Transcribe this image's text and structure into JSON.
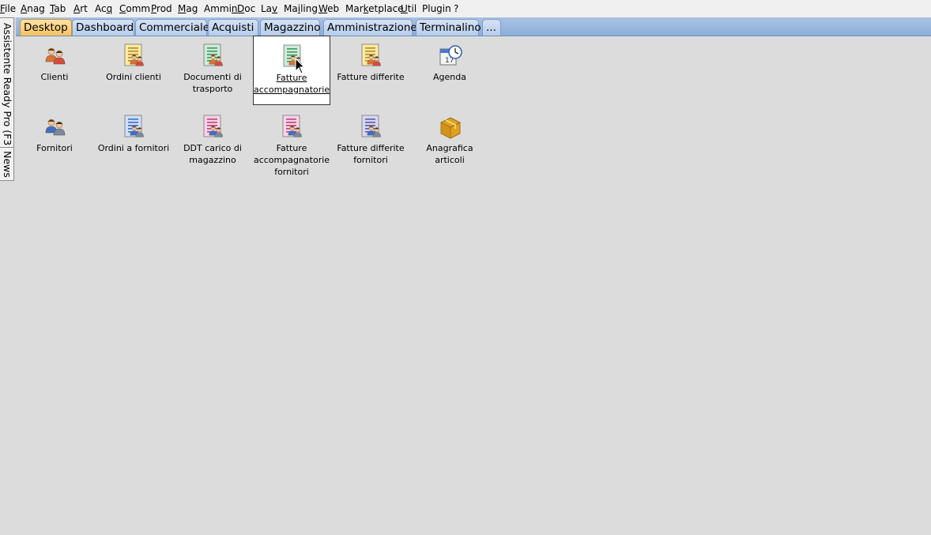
{
  "menu": [
    {
      "pre": "",
      "u": "F",
      "post": "ile"
    },
    {
      "pre": "",
      "u": "A",
      "post": "nag"
    },
    {
      "pre": "",
      "u": "T",
      "post": "ab"
    },
    {
      "pre": "",
      "u": "A",
      "post": "rt"
    },
    {
      "pre": "Ac",
      "u": "q",
      "post": ""
    },
    {
      "pre": "",
      "u": "C",
      "post": "omm"
    },
    {
      "pre": "",
      "u": "P",
      "post": "rod"
    },
    {
      "pre": "",
      "u": "M",
      "post": "ag"
    },
    {
      "pre": "Ammi",
      "u": "n",
      "post": ""
    },
    {
      "pre": "",
      "u": "D",
      "post": "oc"
    },
    {
      "pre": "La",
      "u": "v",
      "post": ""
    },
    {
      "pre": "Ma",
      "u": "i",
      "post": "ling"
    },
    {
      "pre": "",
      "u": "W",
      "post": "eb"
    },
    {
      "pre": "Mar",
      "u": "k",
      "post": "etplace"
    },
    {
      "pre": "",
      "u": "U",
      "post": "til"
    },
    {
      "pre": "Plugin",
      "u": "",
      "post": ""
    },
    {
      "pre": "?",
      "u": "",
      "post": ""
    }
  ],
  "tabs": [
    "Desktop",
    "Dashboard",
    "Commerciale",
    "Acquisti",
    "Magazzino",
    "Amministrazione",
    "Terminalino",
    "..."
  ],
  "active_tab": "Desktop",
  "side_tabs": [
    "Assistente Ready Pro (F3)",
    "News"
  ],
  "icons": [
    {
      "label": "Clienti",
      "icon": "customers-icon",
      "selected": false
    },
    {
      "label": "Ordini clienti",
      "icon": "customer-orders-icon",
      "selected": false
    },
    {
      "label": "Documenti di trasporto",
      "icon": "transport-documents-icon",
      "selected": false
    },
    {
      "label": "Fatture accompagnatorie",
      "icon": "accompanying-invoices-icon",
      "selected": true
    },
    {
      "label": "Fatture differite",
      "icon": "deferred-invoices-icon",
      "selected": false
    },
    {
      "label": "Agenda",
      "icon": "calendar-clock-icon",
      "selected": false
    },
    {
      "label": "Fornitori",
      "icon": "suppliers-icon",
      "selected": false
    },
    {
      "label": "Ordini a fornitori",
      "icon": "supplier-orders-icon",
      "selected": false
    },
    {
      "label": "DDT carico di magazzino",
      "icon": "warehouse-ddt-icon",
      "selected": false
    },
    {
      "label": "Fatture accompagnatorie fornitori",
      "icon": "supplier-accompanying-invoices-icon",
      "selected": false
    },
    {
      "label": "Fatture differite fornitori",
      "icon": "supplier-deferred-invoices-icon",
      "selected": false
    },
    {
      "label": "Anagrafica articoli",
      "icon": "articles-box-icon",
      "selected": false
    }
  ],
  "colors": {
    "background": "#dcdcdc",
    "tab_active": "#f8c25e",
    "tab_inactive": "#c6d8ef",
    "tabstrip": "#98b5de"
  }
}
